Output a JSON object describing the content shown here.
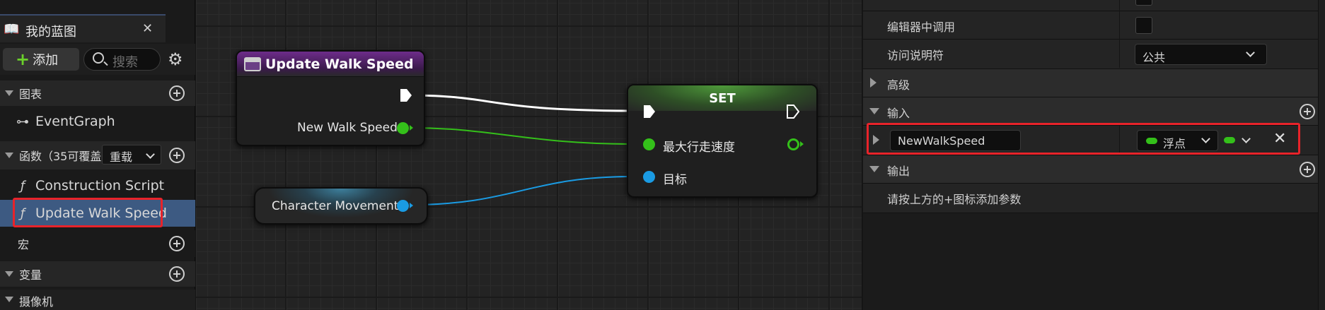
{
  "colors": {
    "accent_red": "#e8232a",
    "pin_float": "#34c01a",
    "pin_object": "#1a9be3",
    "function_header": "#6d2c8a"
  },
  "my_blueprint": {
    "tab_title": "我的蓝图",
    "add_label": "添加",
    "search_placeholder": "搜索",
    "sections": {
      "graphs": "图表",
      "functions": "函数（35可覆盖",
      "override_label": "重载",
      "macros": "宏",
      "variables": "变量",
      "camera": "摄像机"
    },
    "items": {
      "event_graph": "EventGraph",
      "construction_script": "Construction Script",
      "update_walk_speed": "Update Walk Speed"
    }
  },
  "graph": {
    "function_node": {
      "title": "Update Walk Speed",
      "pin_label": "New Walk Speed"
    },
    "set_node": {
      "title": "SET",
      "pin_max_walk_speed": "最大行走速度",
      "pin_target": "目标"
    },
    "var_node": {
      "label": "Character Movement"
    }
  },
  "details": {
    "rows": {
      "call_in_editor": "编辑器中调用",
      "access_specifier": "访问说明符",
      "access_value": "公共",
      "advanced": "高级",
      "inputs": "输入",
      "param_name": "NewWalkSpeed",
      "param_type": "浮点",
      "outputs": "输出",
      "outputs_hint": "请按上方的+图标添加参数"
    }
  }
}
